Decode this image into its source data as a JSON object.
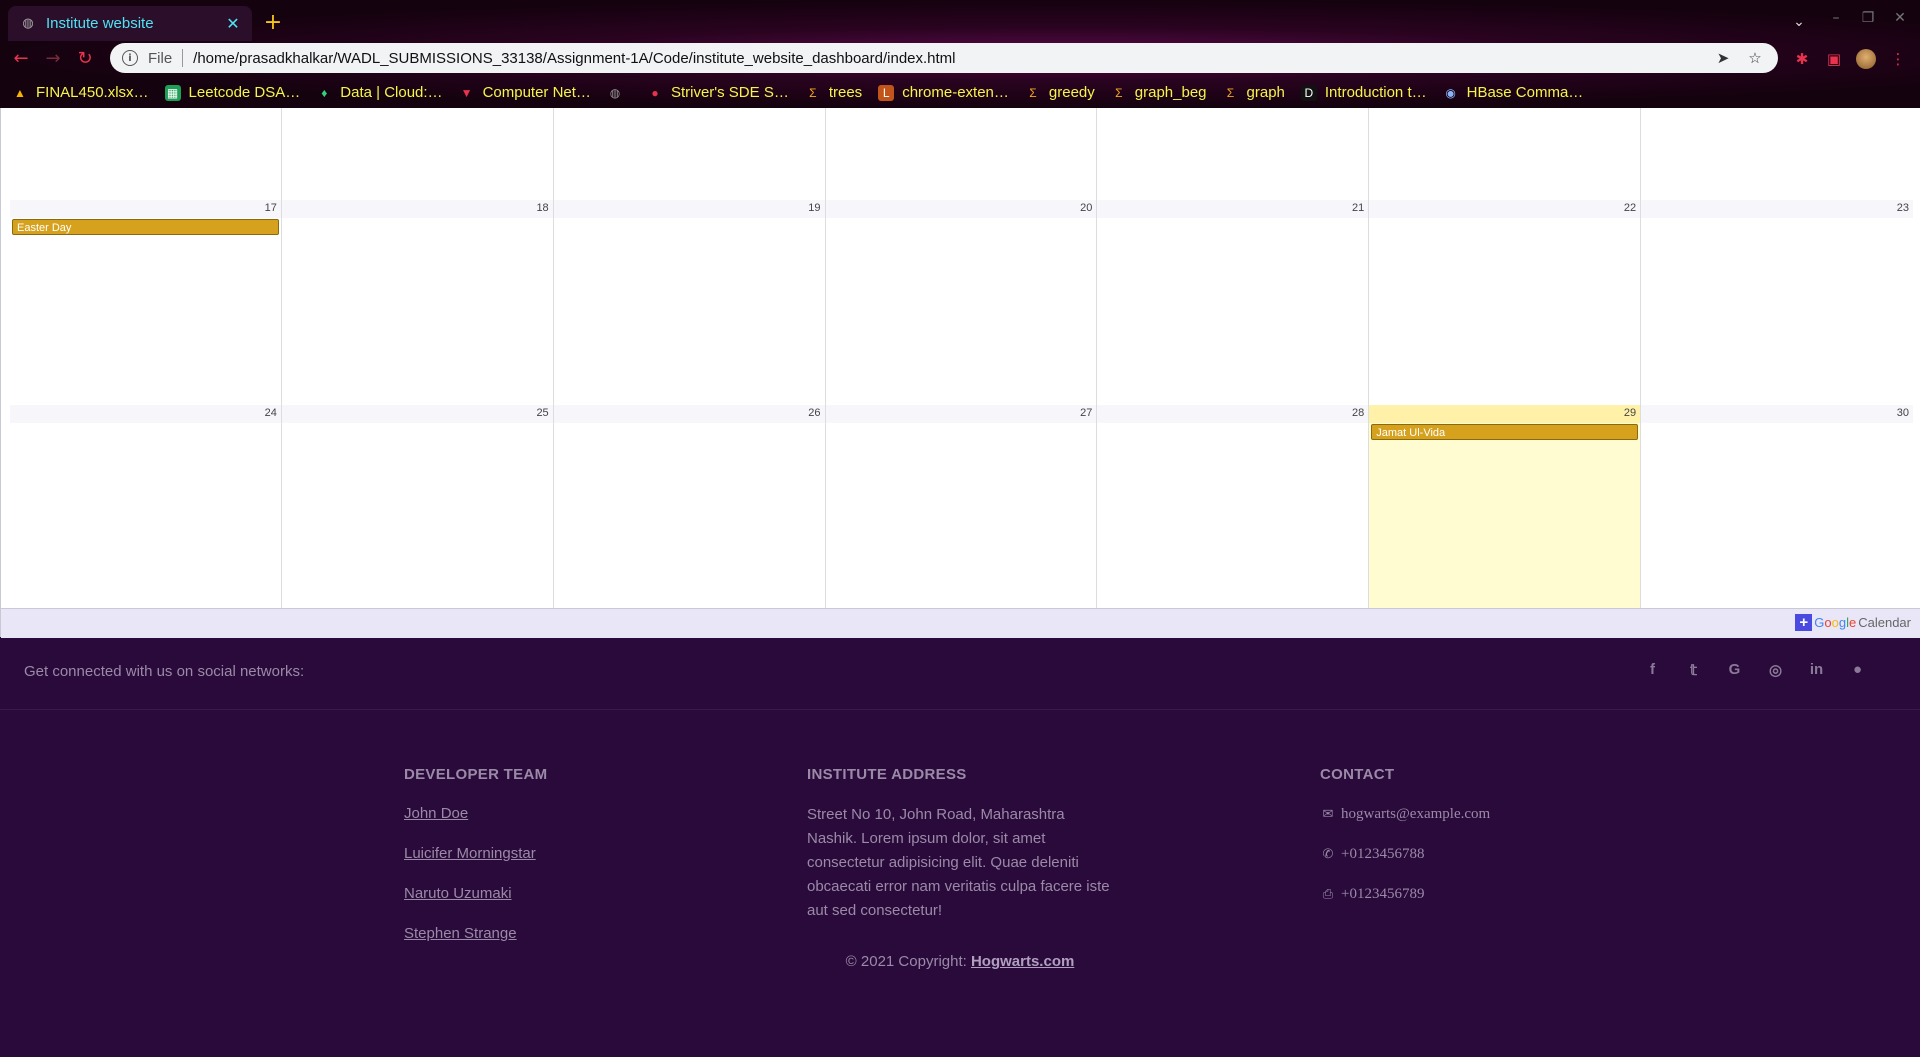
{
  "browser": {
    "tab_title": "Institute website",
    "omnibox_scheme": "File",
    "url": "/home/prasadkhalkar/WADL_SUBMISSIONS_33138/Assignment-1A/Code/institute_website_dashboard/index.html",
    "bookmarks": [
      {
        "label": "FINAL450.xlsx…",
        "icon": "google-drive-icon"
      },
      {
        "label": "Leetcode DSA…",
        "icon": "google-sheets-icon"
      },
      {
        "label": "Data | Cloud:…",
        "icon": "leaf-icon"
      },
      {
        "label": "Computer Net…",
        "icon": "triangle-logo-icon"
      },
      {
        "label": "",
        "icon": "globe-icon"
      },
      {
        "label": "Striver's SDE S…",
        "icon": "tuf-logo-icon"
      },
      {
        "label": "trees",
        "icon": "sigma-icon"
      },
      {
        "label": "chrome-exten…",
        "icon": "lb-logo-icon"
      },
      {
        "label": "greedy",
        "icon": "sigma-icon"
      },
      {
        "label": "graph_beg",
        "icon": "sigma-icon"
      },
      {
        "label": "graph",
        "icon": "sigma-icon"
      },
      {
        "label": "Introduction t…",
        "icon": "dev-logo-icon"
      },
      {
        "label": "HBase Comma…",
        "icon": "hbase-icon"
      }
    ]
  },
  "calendar": {
    "rows": [
      {
        "days": [
          "",
          "",
          "",
          "",
          "",
          "",
          ""
        ]
      },
      {
        "days": [
          "17",
          "18",
          "19",
          "20",
          "21",
          "22",
          "23"
        ]
      },
      {
        "days": [
          "24",
          "25",
          "26",
          "27",
          "28",
          "29",
          "30"
        ]
      }
    ],
    "events": [
      {
        "row": 1,
        "col": 0,
        "title": "Easter Day"
      },
      {
        "row": 2,
        "col": 5,
        "title": "Jamat Ul-Vida"
      }
    ],
    "today": {
      "row": 2,
      "col": 5
    },
    "badge_text": "Calendar",
    "badge_brand": "Google"
  },
  "footer": {
    "social_text": "Get connected with us on social networks:",
    "social_icons": [
      "facebook-icon",
      "twitter-icon",
      "google-icon",
      "instagram-icon",
      "linkedin-icon",
      "github-icon"
    ],
    "dev_heading": "DEVELOPER TEAM",
    "developers": [
      "John Doe",
      "Luicifer Morningstar",
      "Naruto Uzumaki",
      "Stephen Strange"
    ],
    "address_heading": "INSTITUTE ADDRESS",
    "address_text": "Street No 10, John Road, Maharashtra Nashik. Lorem ipsum dolor, sit amet consectetur adipisicing elit. Quae deleniti obcaecati error nam veritatis culpa facere iste aut sed consectetur!",
    "contact_heading": "CONTACT",
    "email": "hogwarts@example.com",
    "phone": "+0123456788",
    "fax": "+0123456789",
    "copyright_prefix": "© 2021 Copyright:",
    "copyright_link": "Hogwarts.com"
  }
}
